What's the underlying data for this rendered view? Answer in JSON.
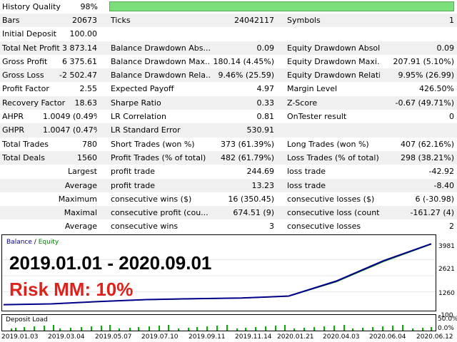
{
  "history_quality": {
    "label": "History Quality",
    "value": "98%",
    "fraction": 0.98
  },
  "rows": [
    [
      "Bars",
      "20673",
      "Ticks",
      "24042117",
      "Symbols",
      "1"
    ],
    [
      "Initial Deposit",
      "100.00",
      "",
      "",
      "",
      ""
    ],
    [
      "Total Net Profit",
      "3 873.14",
      "Balance Drawdown Abs...",
      "0.09",
      "Equity Drawdown Absol...",
      "0.09"
    ],
    [
      "Gross Profit",
      "6 375.61",
      "Balance Drawdown Max...",
      "180.14 (4.45%)",
      "Equity Drawdown Maxi...",
      "207.91 (5.10%)"
    ],
    [
      "Gross Loss",
      "-2 502.47",
      "Balance Drawdown Rela...",
      "9.46% (25.59)",
      "Equity Drawdown Relati...",
      "9.95% (26.99)"
    ],
    [
      "Profit Factor",
      "2.55",
      "Expected Payoff",
      "4.97",
      "Margin Level",
      "426.50%"
    ],
    [
      "Recovery Factor",
      "18.63",
      "Sharpe Ratio",
      "0.33",
      "Z-Score",
      "-0.67 (49.71%)"
    ],
    [
      "AHPR",
      "1.0049 (0.49%)",
      "LR Correlation",
      "0.81",
      "OnTester result",
      "0"
    ],
    [
      "GHPR",
      "1.0047 (0.47%)",
      "LR Standard Error",
      "530.91",
      "",
      ""
    ],
    [
      "Total Trades",
      "780",
      "Short Trades (won %)",
      "373 (61.39%)",
      "Long Trades (won %)",
      "407 (62.16%)"
    ],
    [
      "Total Deals",
      "1560",
      "Profit Trades (% of total)",
      "482 (61.79%)",
      "Loss Trades (% of total)",
      "298 (38.21%)"
    ],
    [
      "",
      "Largest",
      "profit trade",
      "244.69",
      "loss trade",
      "-42.92"
    ],
    [
      "",
      "Average",
      "profit trade",
      "13.23",
      "loss trade",
      "-8.40"
    ],
    [
      "",
      "Maximum",
      "consecutive wins ($)",
      "16 (350.45)",
      "consecutive losses ($)",
      "6 (-30.98)"
    ],
    [
      "",
      "Maximal",
      "consecutive profit (cou...",
      "674.51 (9)",
      "consecutive loss (count)",
      "-161.27 (4)"
    ],
    [
      "",
      "Average",
      "consecutive wins",
      "3",
      "consecutive losses",
      "2"
    ]
  ],
  "chart": {
    "legend_balance": "Balance",
    "legend_sep": "/",
    "legend_equity": "Equity",
    "overlay_dates": "2019.01.01 - 2020.09.01",
    "overlay_risk": "Risk MM: 10%",
    "deposit_label": "Deposit Load",
    "colors": {
      "balance": "#00008b",
      "equity": "#008000",
      "risk_text": "#e0201a",
      "deposit_bars": "#00b000"
    },
    "y_ticks": [
      "3981",
      "2621",
      "1260",
      "-100"
    ],
    "deposit_ticks": [
      "50.0%",
      "0.0%"
    ],
    "x_ticks": [
      "2019.01.03",
      "2019.03.04",
      "2019.05.07",
      "2019.07.10",
      "2019.09.11",
      "2019.11.14",
      "2020.01.21",
      "2020.04.03",
      "2020.06.04",
      "2020.06.12"
    ]
  },
  "chart_data": {
    "type": "line",
    "ylim": [
      -100,
      3981
    ],
    "x": [
      "2019.01.03",
      "2019.03.04",
      "2019.05.07",
      "2019.07.10",
      "2019.09.11",
      "2019.11.14",
      "2020.01.21",
      "2020.04.03",
      "2020.06.04",
      "2020.06.12"
    ],
    "series": [
      {
        "name": "Balance",
        "values": [
          100,
          150,
          300,
          420,
          480,
          520,
          650,
          1600,
          2900,
          3973
        ]
      },
      {
        "name": "Equity",
        "values": [
          100,
          145,
          295,
          415,
          470,
          515,
          640,
          1560,
          2850,
          3950
        ]
      }
    ]
  }
}
